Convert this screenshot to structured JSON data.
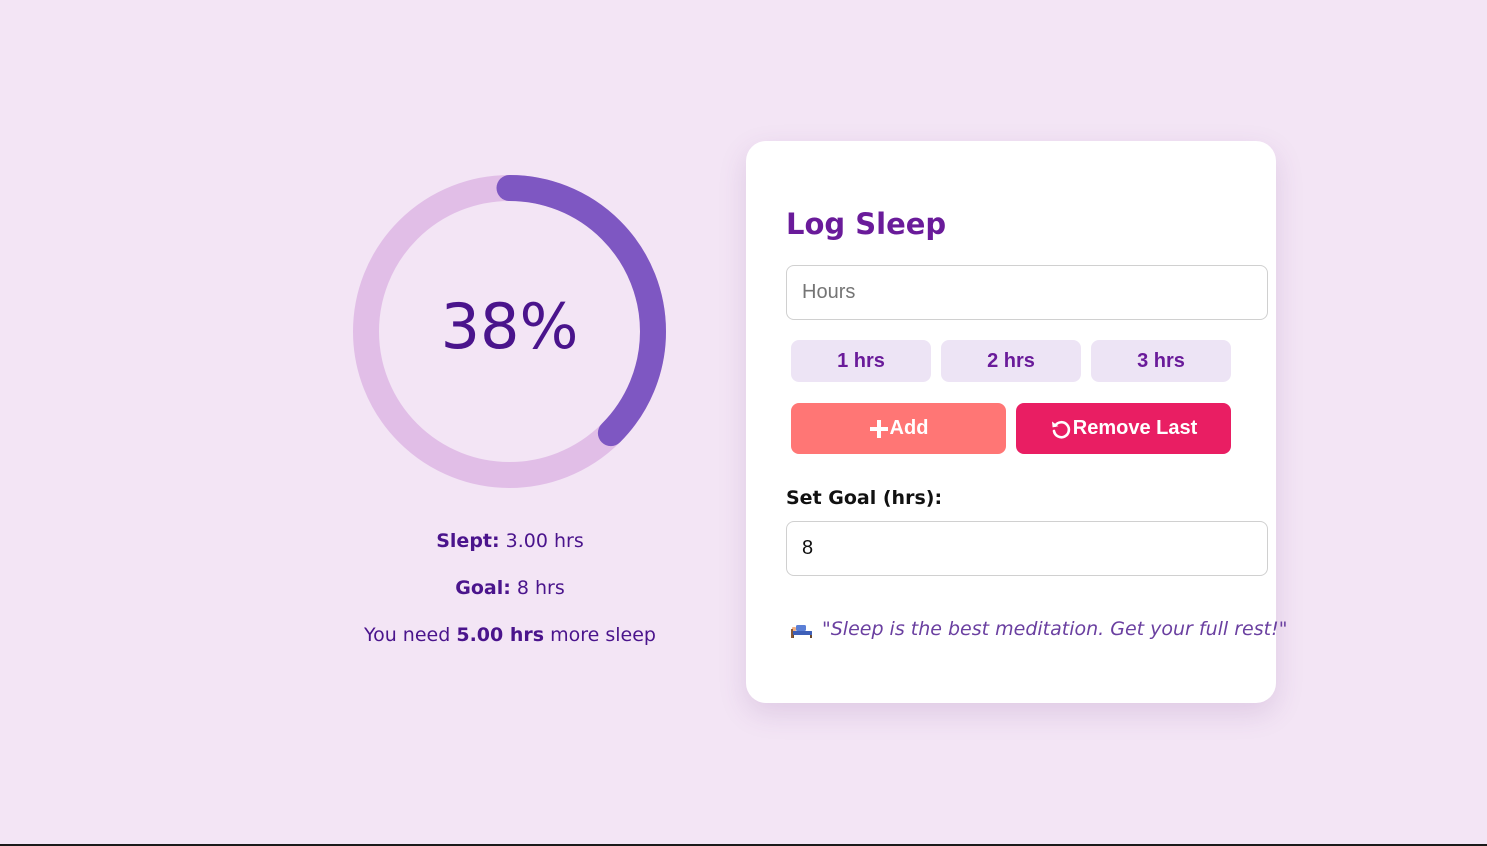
{
  "progress": {
    "percent_label": "38%",
    "fraction": 0.375,
    "track_color": "#e1bee7",
    "fill_color": "#7e57c2"
  },
  "stats": {
    "slept_label": "Slept:",
    "slept_value": "3.00 hrs",
    "goal_label": "Goal:",
    "goal_value": "8 hrs",
    "need_prefix": "You need",
    "need_value": "5.00 hrs",
    "need_suffix": "more sleep"
  },
  "card": {
    "title": "Log Sleep",
    "hours_placeholder": "Hours",
    "hours_value": "",
    "quick_buttons": [
      "1 hrs",
      "2 hrs",
      "3 hrs"
    ],
    "add_label": "Add",
    "add_icon": "plus-icon",
    "remove_label": "Remove Last",
    "remove_icon": "undo-icon",
    "goal_label": "Set Goal (hrs):",
    "goal_value": "8",
    "quote_icon": "bed-icon",
    "quote": "\"Sleep is the best meditation. Get your full rest!\""
  },
  "colors": {
    "background": "#f3e5f5",
    "title": "#6a1b9a",
    "add_button": "#ff7675",
    "remove_button": "#e91e63",
    "quick_button_bg": "#ede4f5"
  }
}
